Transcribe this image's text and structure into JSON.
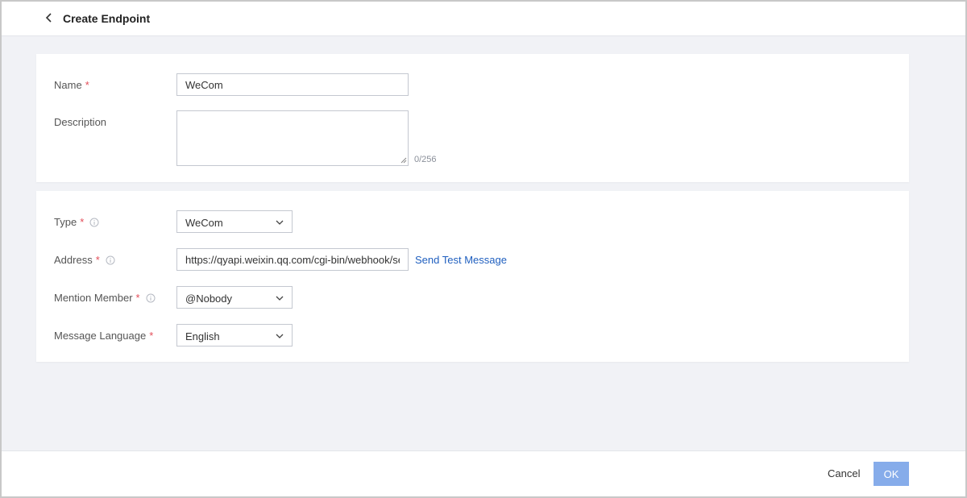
{
  "header": {
    "back_icon": "chevron-left-icon",
    "title": "Create Endpoint"
  },
  "basic": {
    "name": {
      "label": "Name",
      "required_mark": "*",
      "value": "WeCom"
    },
    "description": {
      "label": "Description",
      "value": "",
      "counter": "0/256"
    }
  },
  "config": {
    "type": {
      "label": "Type",
      "required_mark": "*",
      "info_icon": "info-circle-icon",
      "value": "WeCom"
    },
    "address": {
      "label": "Address",
      "required_mark": "*",
      "info_icon": "info-circle-icon",
      "value": "https://qyapi.weixin.qq.com/cgi-bin/webhook/se",
      "test_link": "Send Test Message"
    },
    "mention": {
      "label": "Mention Member",
      "required_mark": "*",
      "info_icon": "info-circle-icon",
      "value": "@Nobody"
    },
    "language": {
      "label": "Message Language",
      "required_mark": "*",
      "value": "English"
    }
  },
  "footer": {
    "cancel_label": "Cancel",
    "ok_label": "OK"
  },
  "colors": {
    "required": "#e34d59",
    "link": "#1f5fbf",
    "primary_disabled": "#86acea",
    "page_bg": "#f1f2f6"
  }
}
